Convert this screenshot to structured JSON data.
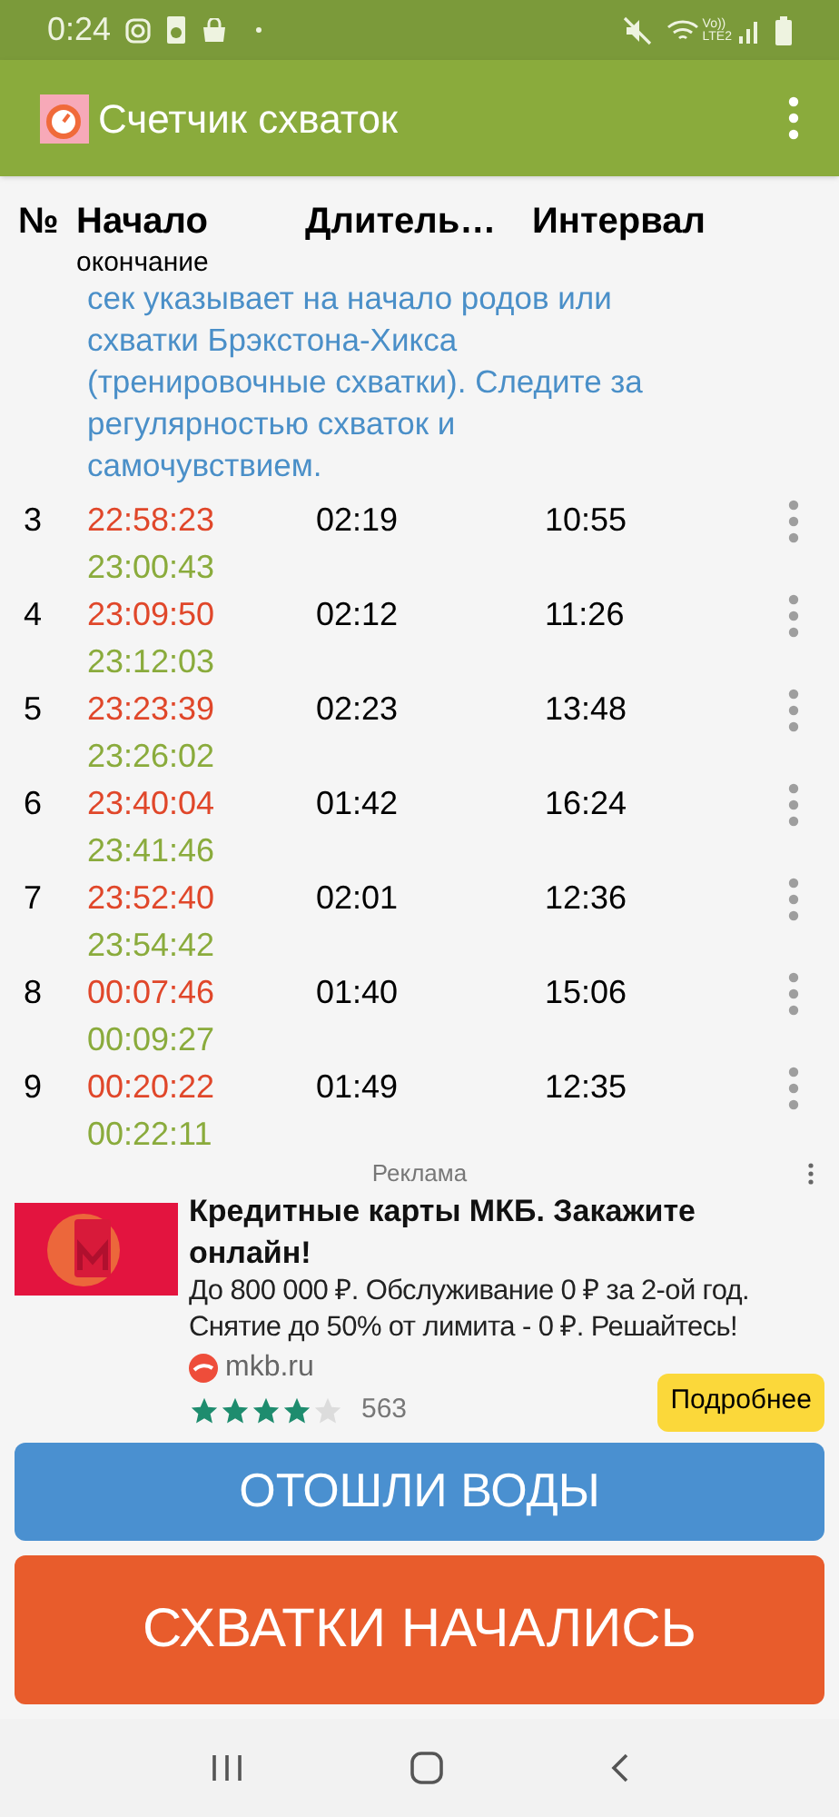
{
  "status_bar": {
    "time": "0:24",
    "network": [
      "Vo))",
      "LTE2"
    ]
  },
  "app_bar": {
    "title": "Счетчик схваток"
  },
  "table": {
    "columns": [
      "№",
      "Начало",
      "Длитель…",
      "Интервал"
    ],
    "subheader": "окончание",
    "note": "сек указывает на начало родов или схватки Брэкстона-Хикса (тренировочные схватки). Следите за регулярностью схваток и самочувствием.",
    "rows": [
      {
        "number": "3",
        "start": "22:58:23",
        "end": "23:00:43",
        "duration": "02:19",
        "interval": "10:55"
      },
      {
        "number": "4",
        "start": "23:09:50",
        "end": "23:12:03",
        "duration": "02:12",
        "interval": "11:26"
      },
      {
        "number": "5",
        "start": "23:23:39",
        "end": "23:26:02",
        "duration": "02:23",
        "interval": "13:48"
      },
      {
        "number": "6",
        "start": "23:40:04",
        "end": "23:41:46",
        "duration": "01:42",
        "interval": "16:24"
      },
      {
        "number": "7",
        "start": "23:52:40",
        "end": "23:54:42",
        "duration": "02:01",
        "interval": "12:36"
      },
      {
        "number": "8",
        "start": "00:07:46",
        "end": "00:09:27",
        "duration": "01:40",
        "interval": "15:06"
      },
      {
        "number": "9",
        "start": "00:20:22",
        "end": "00:22:11",
        "duration": "01:49",
        "interval": "12:35"
      }
    ]
  },
  "ad": {
    "label": "Реклама",
    "title": "Кредитные карты МКБ. Закажите онлайн!",
    "body": "До 800 000 ₽. Обслуживание 0 ₽ за 2-ой год. Снятие до 50% от лимита - 0 ₽. Решайтесь!",
    "domain": "mkb.ru",
    "stars": 4,
    "reviews": "563",
    "cta": "Подробнее"
  },
  "buttons": [
    {
      "label": "ОТОШЛИ ВОДЫ",
      "kind": "water"
    },
    {
      "label": "СХВАТКИ НАЧАЛИСЬ",
      "kind": "start"
    }
  ]
}
